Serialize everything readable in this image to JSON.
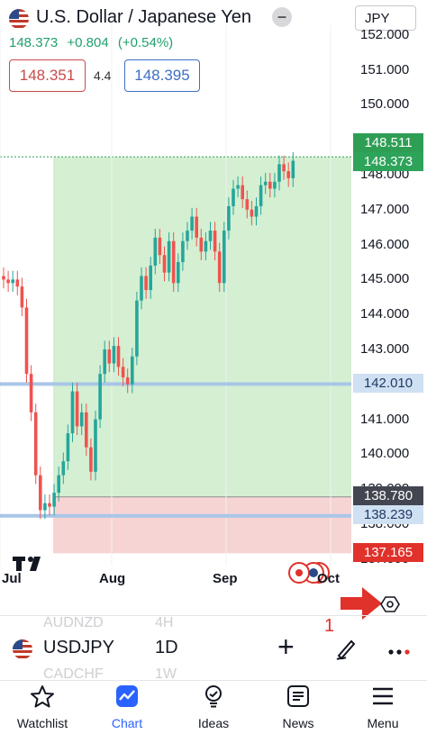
{
  "header": {
    "title": "U.S. Dollar / Japanese Yen",
    "currency_selector": "JPY",
    "last_price": "148.373",
    "change_abs": "+0.804",
    "change_pct": "(+0.54%)",
    "bid": "148.351",
    "spread": "4.4",
    "ask": "148.395"
  },
  "price_axis": {
    "labels": [
      "152.000",
      "151.000",
      "150.000",
      "148.000",
      "147.000",
      "146.000",
      "145.000",
      "144.000",
      "143.000",
      "141.000",
      "140.000",
      "139.000",
      "138.000",
      "137.000"
    ],
    "tags": {
      "high_line": "148.511",
      "last": "148.373",
      "level_1": "142.010",
      "level_2": "138.780",
      "level_3": "138.239",
      "low_line": "137.165"
    }
  },
  "time_axis": {
    "labels": [
      "Jul",
      "Aug",
      "Sep",
      "Oct"
    ]
  },
  "chart_data": {
    "type": "candlestick",
    "ylim": [
      136.5,
      152.3
    ],
    "x": [
      "Jul",
      "Aug",
      "Sep",
      "Oct"
    ],
    "horizontal_levels": [
      142.01,
      138.239
    ],
    "zone_top": 148.511,
    "zone_entry": 138.78,
    "zone_bottom": 137.165,
    "colors": {
      "up": "#26a69a",
      "down": "#ef5350",
      "profit_zone": "#d4efd2",
      "loss_zone": "#f7d4d4",
      "level_line": "#a9c6e8"
    }
  },
  "annotation": {
    "number": "1"
  },
  "symbol_bar": {
    "faded_above_symbol": "AUDNZD",
    "faded_above_tf": "4H",
    "symbol": "USDJPY",
    "timeframe": "1D",
    "faded_below_symbol": "CADCHF",
    "faded_below_tf": "1W"
  },
  "bottom_nav": [
    {
      "label": "Watchlist",
      "icon": "star-icon"
    },
    {
      "label": "Chart",
      "icon": "chart-icon"
    },
    {
      "label": "Ideas",
      "icon": "ideas-icon"
    },
    {
      "label": "News",
      "icon": "news-icon"
    },
    {
      "label": "Menu",
      "icon": "menu-icon"
    }
  ]
}
